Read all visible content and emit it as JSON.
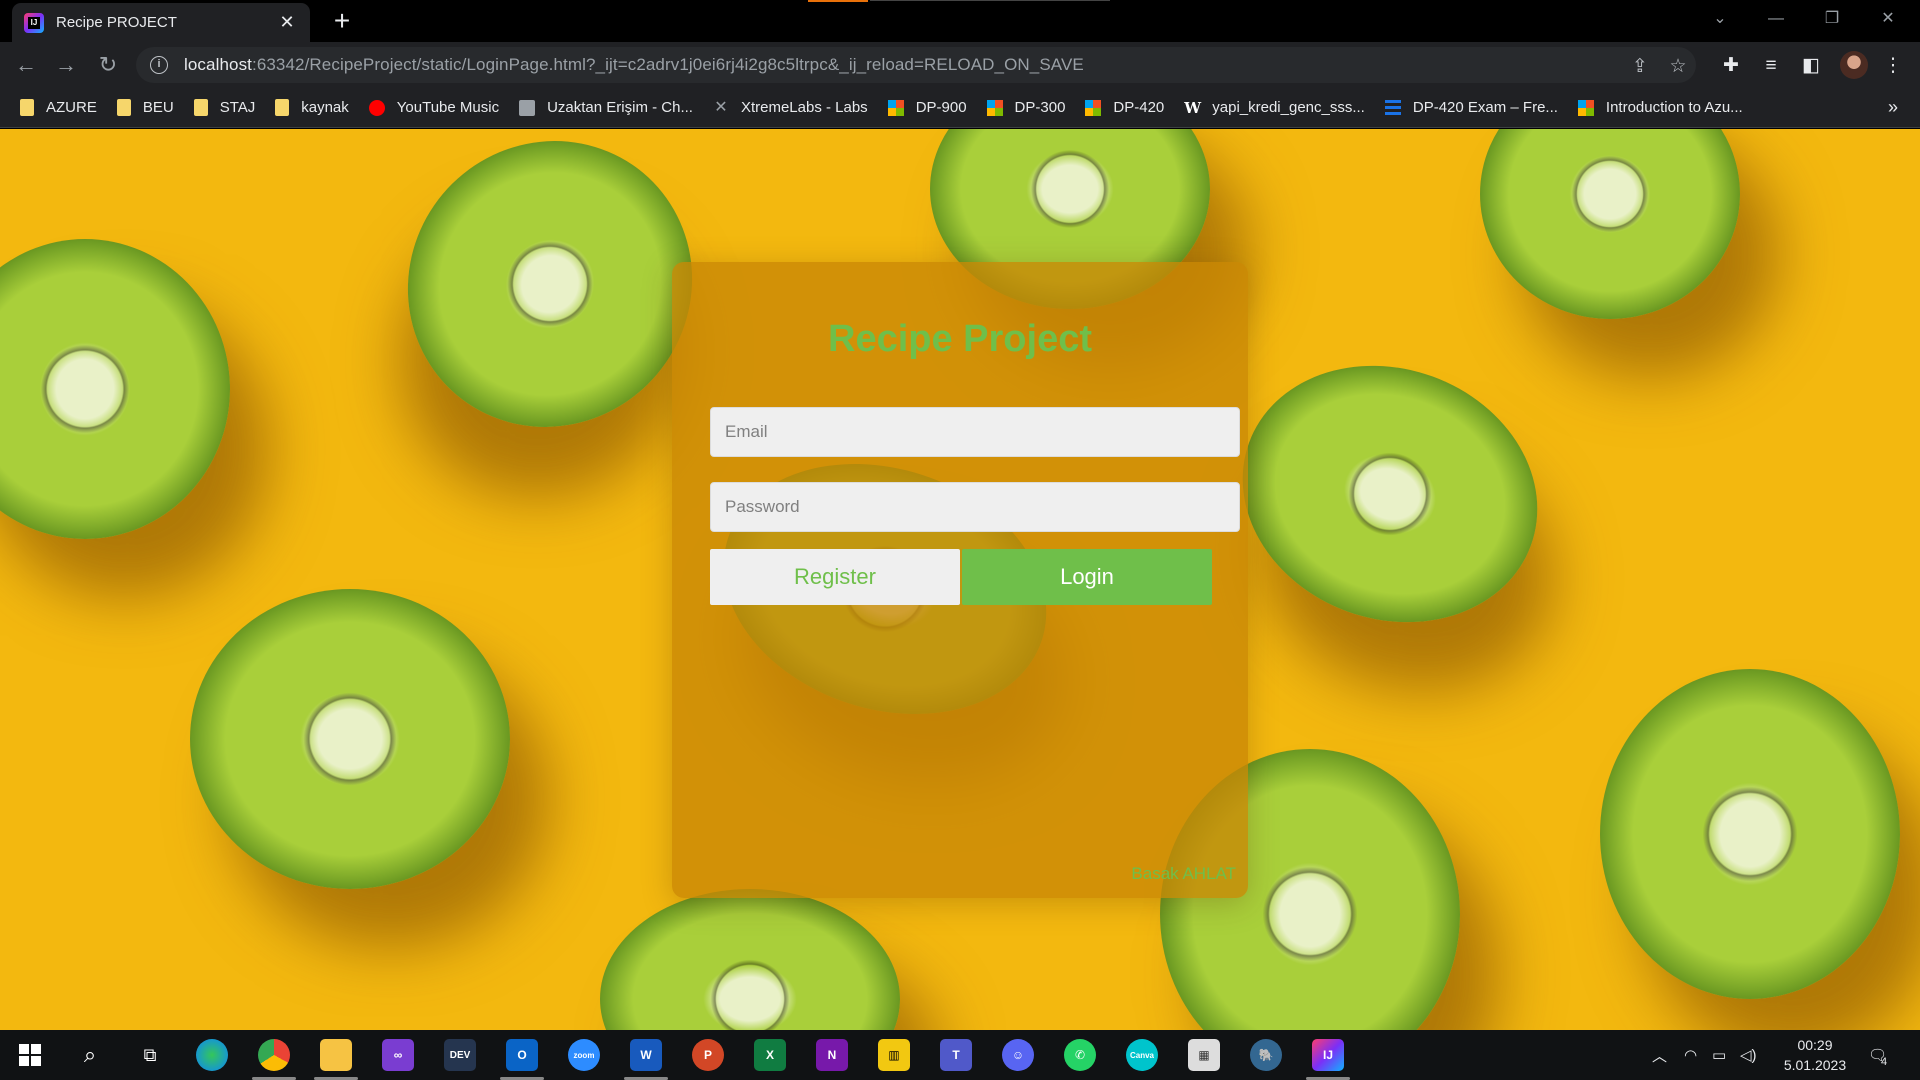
{
  "browser": {
    "tab_title": "Recipe PROJECT",
    "tab_close": "✕",
    "new_tab": "+",
    "url_host": "localhost",
    "url_rest": ":63342/RecipeProject/static/LoginPage.html?_ijt=c2adrv1j0ei6rj4i2g8c5ltrpc&_ij_reload=RELOAD_ON_SAVE",
    "bookmarks": [
      {
        "label": "AZURE",
        "icon": "folder"
      },
      {
        "label": "BEU",
        "icon": "folder"
      },
      {
        "label": "STAJ",
        "icon": "folder"
      },
      {
        "label": "kaynak",
        "icon": "folder"
      },
      {
        "label": "YouTube Music",
        "icon": "youtube-music"
      },
      {
        "label": "Uzaktan Erişim - Ch...",
        "icon": "remote"
      },
      {
        "label": "XtremeLabs - Labs",
        "icon": "xtremelabs"
      },
      {
        "label": "DP-900",
        "icon": "microsoft"
      },
      {
        "label": "DP-300",
        "icon": "microsoft"
      },
      {
        "label": "DP-420",
        "icon": "microsoft"
      },
      {
        "label": "yapi_kredi_genc_sss...",
        "icon": "w"
      },
      {
        "label": "DP-420 Exam – Fre...",
        "icon": "dash"
      },
      {
        "label": "Introduction to Azu...",
        "icon": "microsoft"
      }
    ],
    "bookmarks_more": "»"
  },
  "login": {
    "title": "Recipe Project",
    "email_placeholder": "Email",
    "password_placeholder": "Password",
    "register_label": "Register",
    "login_label": "Login",
    "credit": "Basak AHLAT"
  },
  "taskbar": {
    "time": "00:29",
    "date": "5.01.2023",
    "notification_count": "4"
  },
  "colors": {
    "accent_green": "#6fbf4a",
    "background_yellow": "#f3b80f"
  }
}
